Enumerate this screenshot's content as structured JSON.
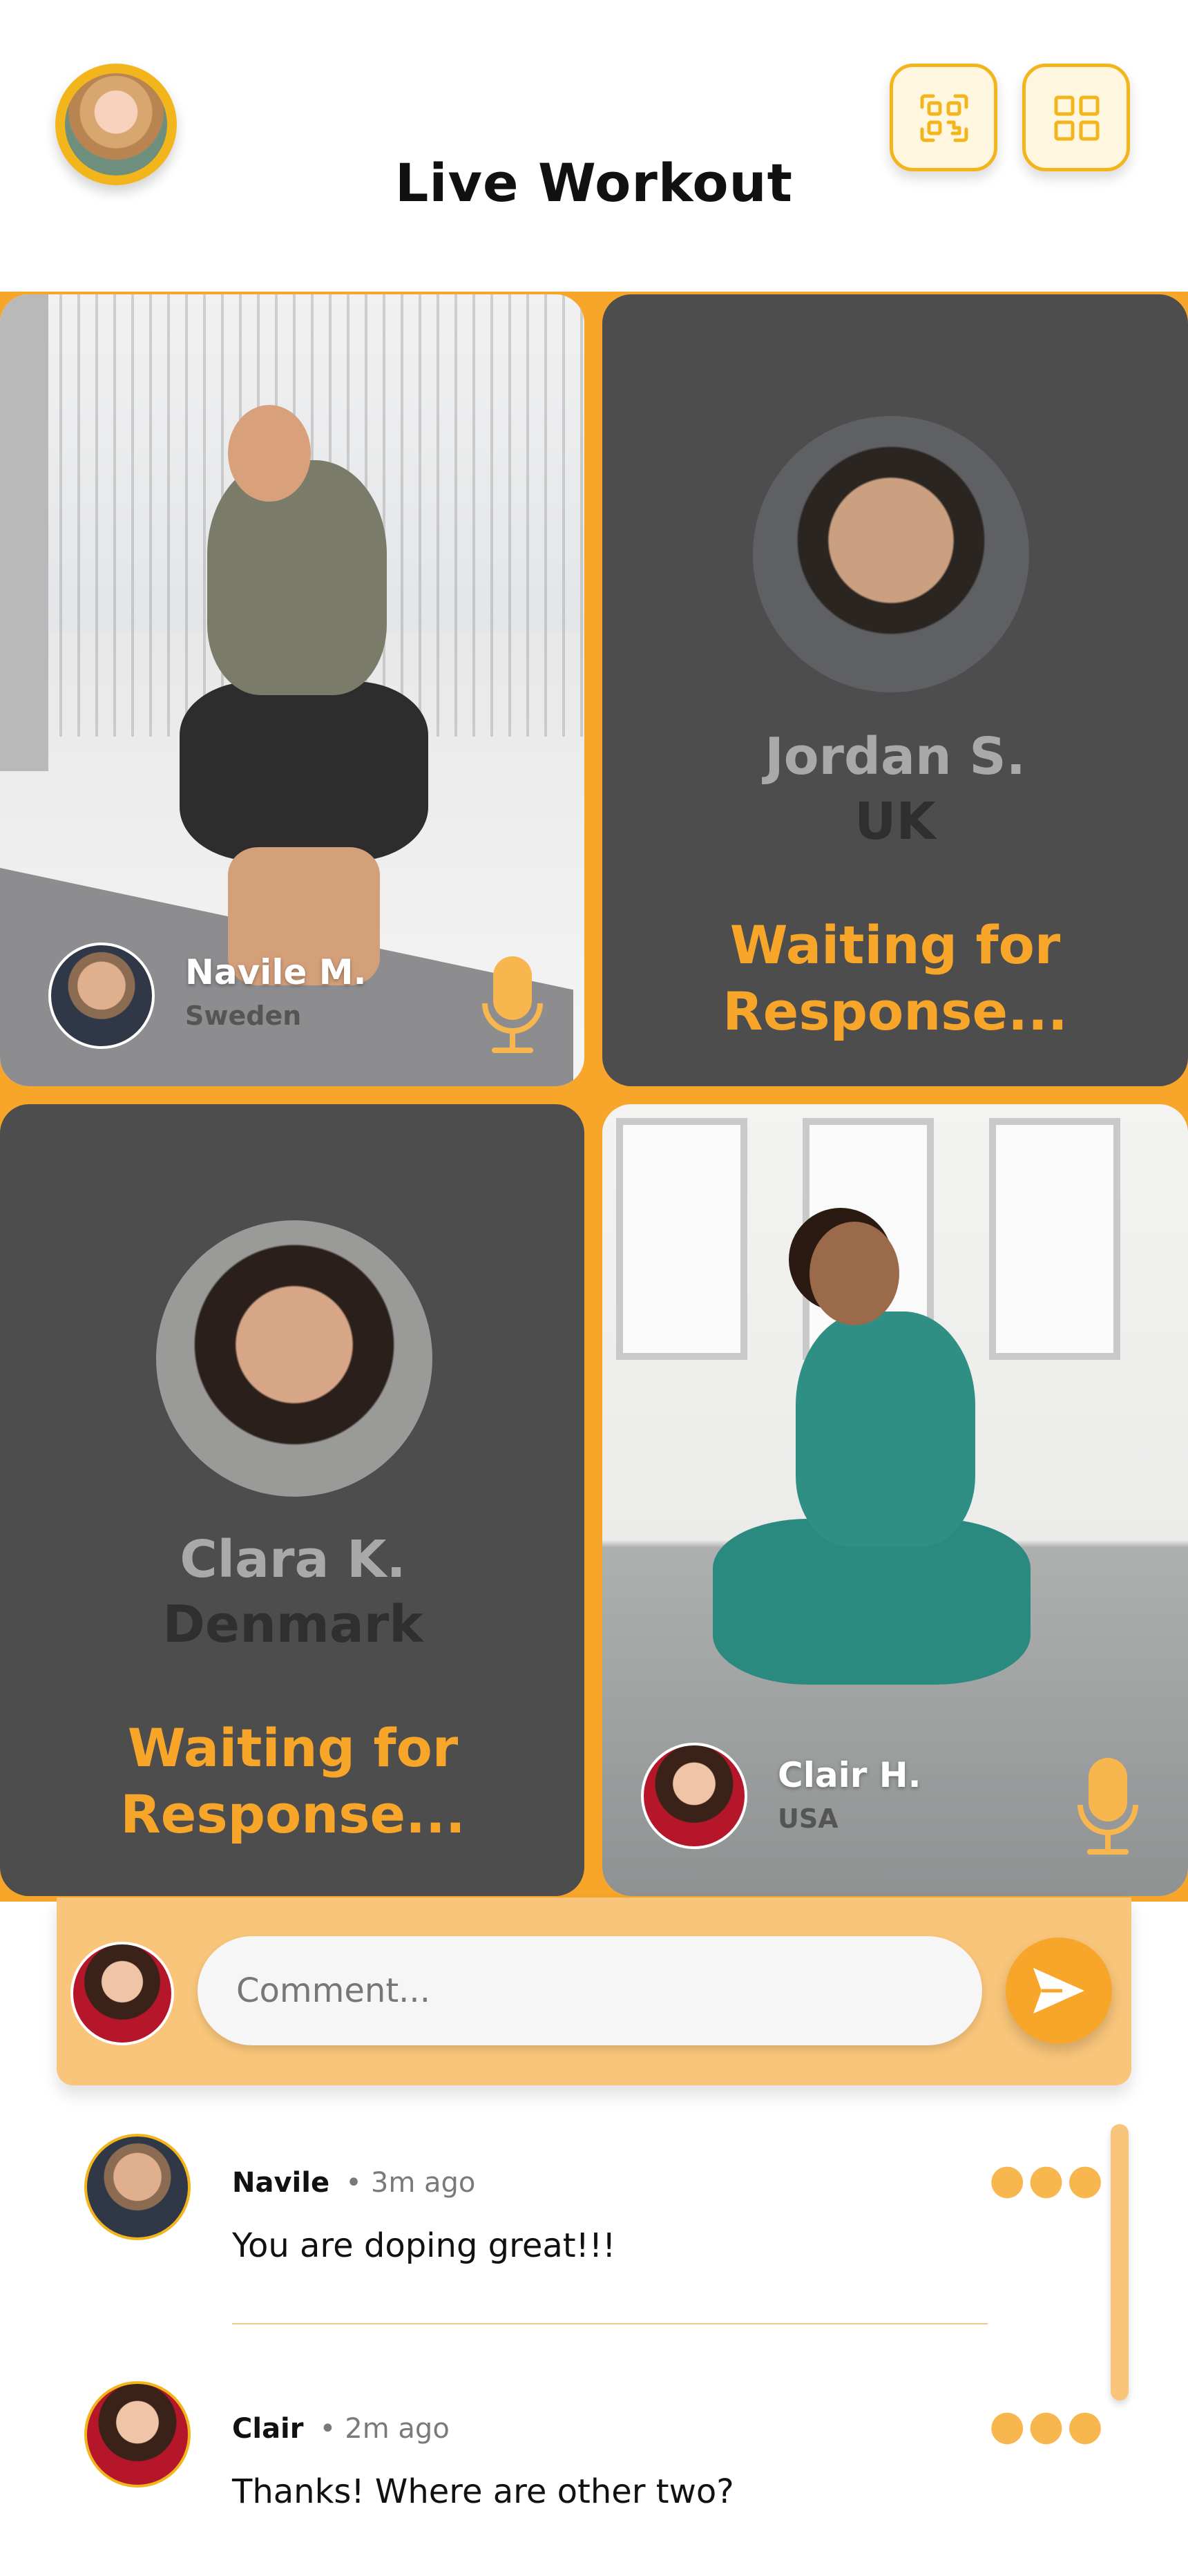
{
  "header": {
    "title": "Live Workout"
  },
  "participants": [
    {
      "name": "Navile M.",
      "country": "Sweden",
      "status": "live"
    },
    {
      "name": "Jordan S.",
      "country": "UK",
      "status": "Waiting for Response..."
    },
    {
      "name": "Clara K.",
      "country": "Denmark",
      "status": "Waiting for Response..."
    },
    {
      "name": "Clair H.",
      "country": "USA",
      "status": "live"
    }
  ],
  "waiting_line1": "Waiting for",
  "waiting_line2": "Response...",
  "comment_input": {
    "placeholder": "Comment..."
  },
  "comments": [
    {
      "author": "Navile",
      "time": "3m ago",
      "text": "You are doping great!!!"
    },
    {
      "author": "Clair",
      "time": "2m ago",
      "text": "Thanks! Where are other two?"
    }
  ],
  "colors": {
    "accent": "#f8a62a",
    "accent_light": "#f8c57a",
    "tile_dark": "#4d4d4d",
    "brand_yellow": "#f2b51b"
  },
  "icons": {
    "header_left": "qr-scan-icon",
    "header_right": "grid-icon",
    "send": "send-icon",
    "mic": "microphone-icon",
    "more": "more-options-icon"
  }
}
